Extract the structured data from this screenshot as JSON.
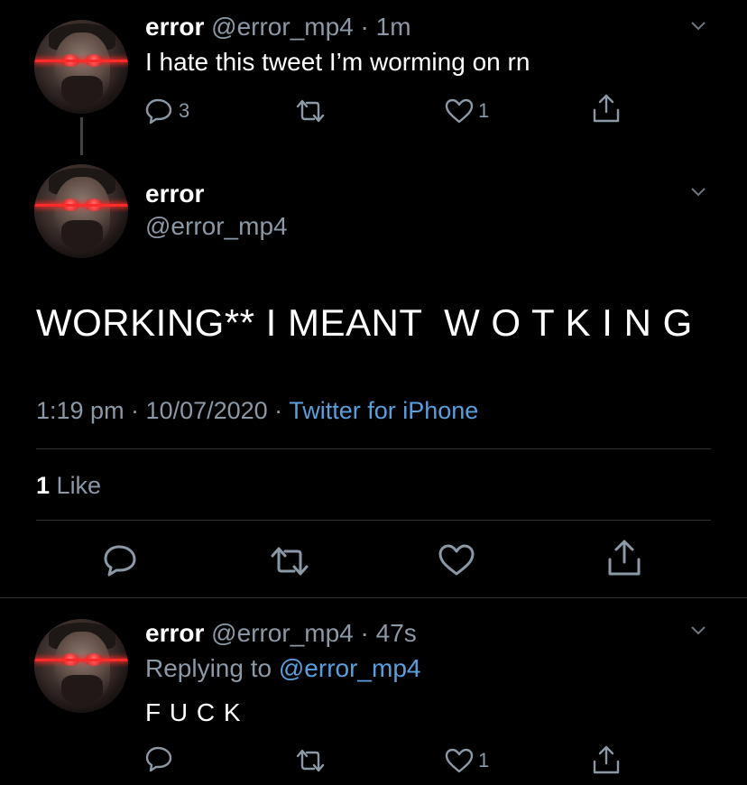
{
  "tweet1": {
    "name": "error",
    "handle": "@error_mp4",
    "time": "· 1m",
    "text": "I hate this tweet I’m worming on rn",
    "replies": "3",
    "likes": "1",
    "icons": [
      "reply-icon",
      "retweet-icon",
      "like-icon",
      "share-icon"
    ]
  },
  "main_tweet": {
    "name": "error",
    "handle": "@error_mp4",
    "text": "WORKING** I MEANT  W O T K I N G",
    "timestamp": "1:19 pm · 10/07/2020 ·",
    "source": "Twitter for iPhone",
    "likes_count": "1",
    "likes_label": "Like"
  },
  "reply_tweet": {
    "name": "error",
    "handle": "@error_mp4",
    "time": "· 47s",
    "replying_prefix": "Replying to",
    "replying_to": "@error_mp4",
    "text": "F U C K",
    "likes": "1"
  },
  "colors": {
    "background": "#000000",
    "text": "#ffffff",
    "secondary": "#8b98a5",
    "link": "#5a9fdc",
    "divider": "#2f3336"
  }
}
